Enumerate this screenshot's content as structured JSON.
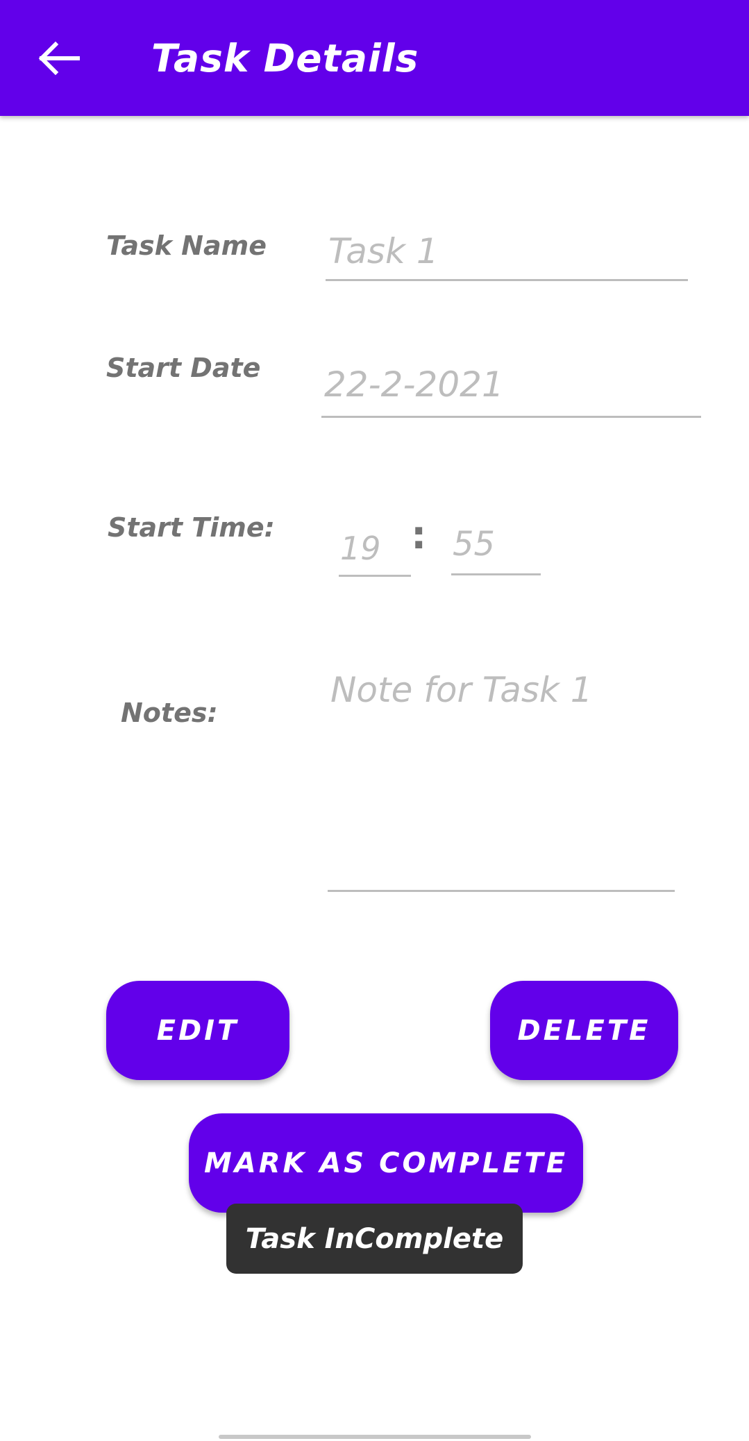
{
  "appbar": {
    "title": "Task Details",
    "back_icon": "arrow-left-icon",
    "color": "#6200ea"
  },
  "form": {
    "task_name": {
      "label": "Task Name",
      "value": "Task 1"
    },
    "start_date": {
      "label": "Start Date",
      "value": "22-2-2021"
    },
    "start_time": {
      "label": "Start Time:",
      "hour": "19",
      "separator": ":",
      "minute": "55"
    },
    "notes": {
      "label": "Notes:",
      "value": "Note for Task 1"
    }
  },
  "buttons": {
    "edit": "EDIT",
    "delete": "DELETE",
    "mark_complete": "MARK AS COMPLETE",
    "color": "#6200ea"
  },
  "toast": {
    "message": "Task InComplete"
  }
}
